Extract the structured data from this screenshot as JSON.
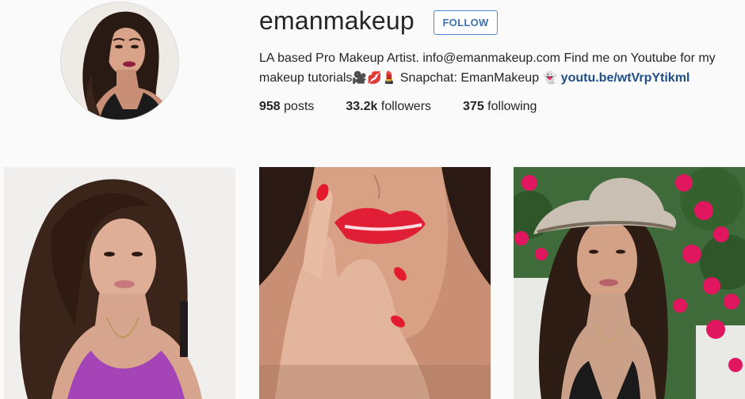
{
  "profile": {
    "username": "emanmakeup",
    "follow_label": "FOLLOW",
    "bio_text": "LA based Pro Makeup Artist. info@emanmakeup.com Find me on Youtube for my makeup tutorials",
    "bio_emoji_1": "🎥💋💄",
    "snapchat_text": " Snapchat: EmanMakeup ",
    "bio_emoji_2": "👻",
    "bio_link": "youtu.be/wtVrpYtikml",
    "stats": {
      "posts_count": "958",
      "posts_label": " posts",
      "followers_count": "33.2k",
      "followers_label": " followers",
      "following_count": "375",
      "following_label": " following"
    }
  },
  "icons": {
    "avatar": "profile-photo",
    "emoji": [
      "movie-camera-icon",
      "kiss-mark-icon",
      "lipstick-icon",
      "ghost-icon"
    ]
  },
  "colors": {
    "background": "#fafafa",
    "follow_border": "#4f8ad8",
    "follow_text": "#3f72af",
    "link": "#1f4f86"
  },
  "posts": [
    {
      "thumbnail": "woman-with-long-hair-purple-top"
    },
    {
      "thumbnail": "red-lips-red-nails-closeup"
    },
    {
      "thumbnail": "woman-in-hat-pink-bougainvillea"
    }
  ]
}
